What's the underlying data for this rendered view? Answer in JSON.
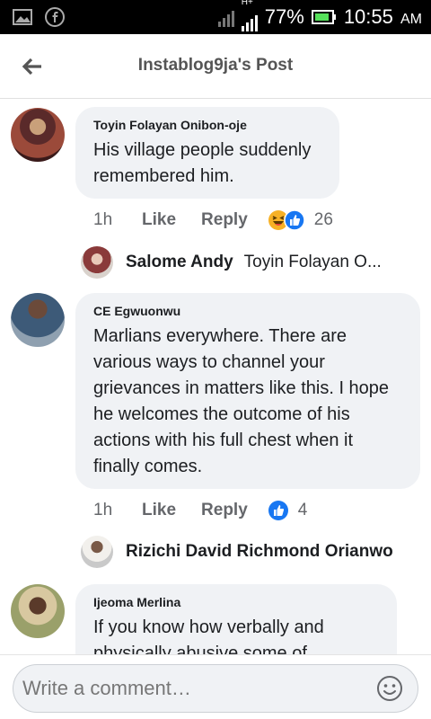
{
  "status_bar": {
    "network": "H+",
    "battery": "77%",
    "time": "10:55",
    "ampm": "AM"
  },
  "header": {
    "title": "Instablog9ja's Post"
  },
  "comments": [
    {
      "author": "Toyin Folayan Onibon-oje",
      "text": "His village people suddenly remembered him.",
      "time": "1h",
      "like_label": "Like",
      "reply_label": "Reply",
      "reaction_count": "26",
      "reply_preview": {
        "author": "Salome Andy",
        "text": "Toyin Folayan O..."
      }
    },
    {
      "author": "CE Egwuonwu",
      "text": "Marlians everywhere. There are various ways to channel your grievances in matters like this. I hope he welcomes the outcome of his actions with his full chest when it finally comes.",
      "time": "1h",
      "like_label": "Like",
      "reply_label": "Reply",
      "reaction_count": "4",
      "reply_preview": {
        "author": "Rizichi David Richmond Orianwo"
      }
    },
    {
      "author": "Ijeoma Merlina",
      "text": "If you know how verbally and physically abusive some of"
    }
  ],
  "composer": {
    "placeholder": "Write a comment…"
  },
  "colors": {
    "like_blue": "#1877f2",
    "bubble_bg": "#f0f2f5",
    "haha_yellow": "#f7b125"
  }
}
